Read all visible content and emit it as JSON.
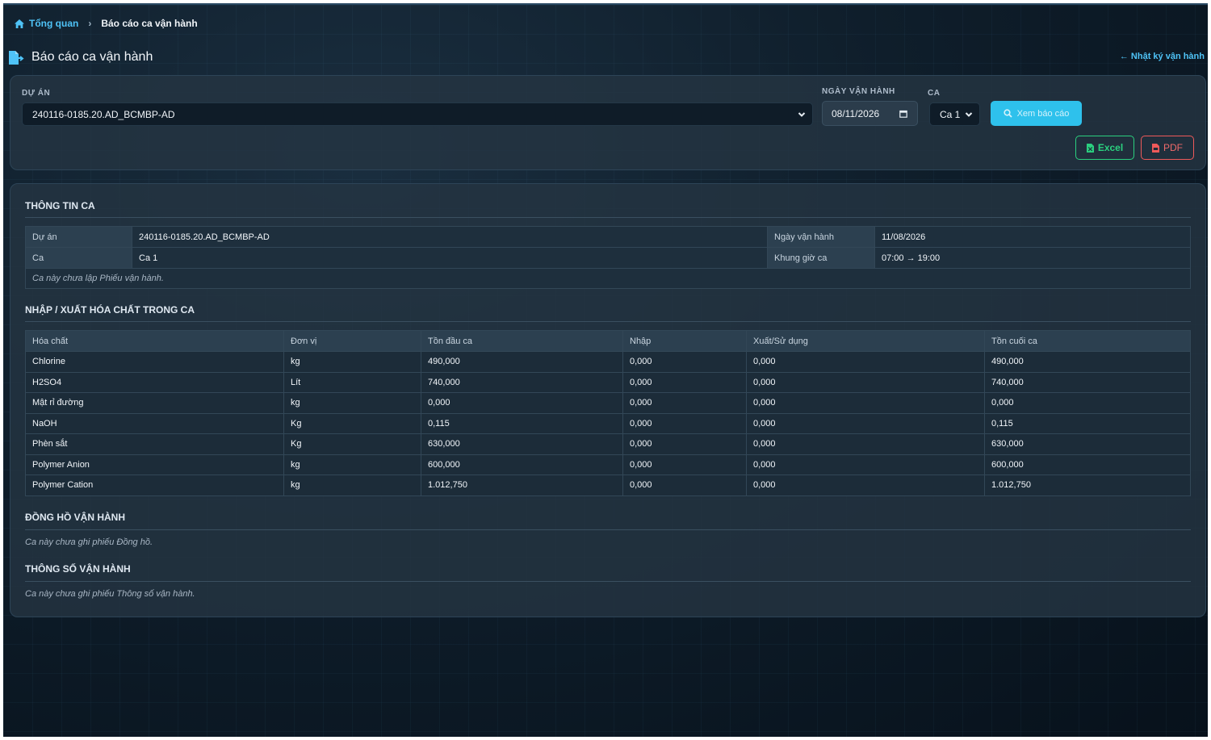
{
  "breadcrumb": {
    "home": "Tổng quan",
    "separator": "›",
    "current": "Báo cáo ca vận hành"
  },
  "page": {
    "title": "Báo cáo ca vận hành",
    "back_link": "← Nhật ký vận hành"
  },
  "filters": {
    "project_label": "DỰ ÁN",
    "project_value": "240116-0185.20.AD_BCMBP-AD",
    "date_label": "NGÀY VẬN HÀNH",
    "date_value": "08/11/2026",
    "shift_label": "CA",
    "shift_value": "Ca 1",
    "view_button": "Xem báo cáo",
    "excel_button": "Excel",
    "pdf_button": "PDF"
  },
  "shift_info": {
    "title": "THÔNG TIN CA",
    "project_label": "Dự án",
    "project_value": "240116-0185.20.AD_BCMBP-AD",
    "date_label": "Ngày vận hành",
    "date_value": "11/08/2026",
    "shift_label": "Ca",
    "shift_value": "Ca 1",
    "time_label": "Khung giờ ca",
    "time_value": "07:00 → 19:00",
    "note": "Ca này chưa lập Phiếu vận hành."
  },
  "chemicals": {
    "title": "NHẬP / XUẤT HÓA CHẤT TRONG CA",
    "headers": [
      "Hóa chất",
      "Đơn vị",
      "Tồn đầu ca",
      "Nhập",
      "Xuất/Sử dụng",
      "Tồn cuối ca"
    ],
    "rows": [
      [
        "Chlorine",
        "kg",
        "490,000",
        "0,000",
        "0,000",
        "490,000"
      ],
      [
        "H2SO4",
        "Lít",
        "740,000",
        "0,000",
        "0,000",
        "740,000"
      ],
      [
        "Mật rỉ đường",
        "kg",
        "0,000",
        "0,000",
        "0,000",
        "0,000"
      ],
      [
        "NaOH",
        "Kg",
        "0,115",
        "0,000",
        "0,000",
        "0,115"
      ],
      [
        "Phèn sắt",
        "Kg",
        "630,000",
        "0,000",
        "0,000",
        "630,000"
      ],
      [
        "Polymer Anion",
        "kg",
        "600,000",
        "0,000",
        "0,000",
        "600,000"
      ],
      [
        "Polymer Cation",
        "kg",
        "1.012,750",
        "0,000",
        "0,000",
        "1.012,750"
      ]
    ]
  },
  "meters": {
    "title": "ĐỒNG HỒ VẬN HÀNH",
    "note": "Ca này chưa ghi phiếu Đồng hồ."
  },
  "params": {
    "title": "THÔNG SỐ VẬN HÀNH",
    "note": "Ca này chưa ghi phiếu Thông số vận hành."
  },
  "colors": {
    "accent": "#2ec1ec",
    "excel": "#2bd07f",
    "pdf": "#ef5a5a",
    "link": "#4fc3f7"
  },
  "icons": {
    "home": "home-icon",
    "title": "file-export-icon",
    "view": "search-icon",
    "excel": "file-excel-icon",
    "pdf": "file-pdf-icon"
  }
}
